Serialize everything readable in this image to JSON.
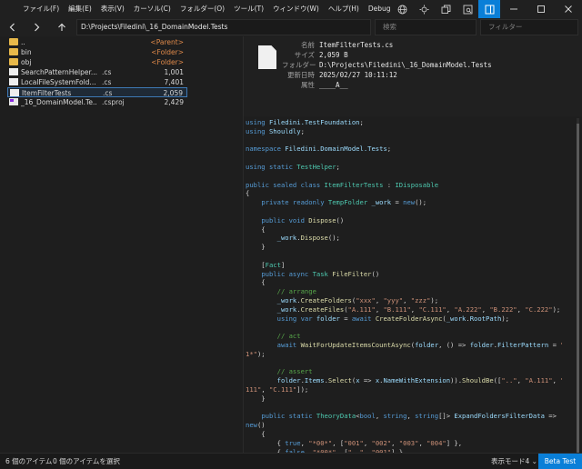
{
  "menu": [
    "ファイル(F)",
    "編集(E)",
    "表示(V)",
    "カーソル(C)",
    "フォルダー(O)",
    "ツール(T)",
    "ウィンドウ(W)",
    "ヘルプ(H)",
    "Debug"
  ],
  "toolbar": {
    "path": "D:\\Projects\\Filedini\\_16_DomainModel.Tests",
    "search_placeholder": "検索",
    "filter_placeholder": "フィルター"
  },
  "files": [
    {
      "name": "..",
      "ext": "",
      "size": "<Parent>",
      "kind": "folder"
    },
    {
      "name": "bin",
      "ext": "",
      "size": "<Folder>",
      "kind": "folder"
    },
    {
      "name": "obj",
      "ext": "",
      "size": "<Folder>",
      "kind": "folder"
    },
    {
      "name": "SearchPatternHelper...",
      "ext": ".cs",
      "size": "1,001",
      "kind": "file"
    },
    {
      "name": "LocalFileSystemFold...",
      "ext": ".cs",
      "size": "7,401",
      "kind": "file"
    },
    {
      "name": "ItemFilterTests",
      "ext": ".cs",
      "size": "2,059",
      "kind": "file",
      "selected": true
    },
    {
      "name": "_16_DomainModel.Te...",
      "ext": ".csproj",
      "size": "2,429",
      "kind": "project"
    }
  ],
  "preview": {
    "meta": [
      {
        "key": "名前",
        "value": "ItemFilterTests.cs"
      },
      {
        "key": "サイズ",
        "value": "2,059 B"
      },
      {
        "key": "フォルダー",
        "value": "D:\\Projects\\Filedini\\_16_DomainModel.Tests"
      },
      {
        "key": "更新日時",
        "value": "2025/02/27 10:11:12"
      },
      {
        "key": "属性",
        "value": "____A__"
      }
    ],
    "code": [
      [
        [
          "kw",
          "using "
        ],
        [
          "id",
          "Filedini.TestFoundation"
        ],
        [
          "pl",
          ";"
        ]
      ],
      [
        [
          "kw",
          "using "
        ],
        [
          "id",
          "Shouldly"
        ],
        [
          "pl",
          ";"
        ]
      ],
      [],
      [
        [
          "kw",
          "namespace "
        ],
        [
          "id",
          "Filedini.DomainModel.Tests"
        ],
        [
          "pl",
          ";"
        ]
      ],
      [],
      [
        [
          "kw",
          "using static "
        ],
        [
          "cls",
          "TestHelper"
        ],
        [
          "pl",
          ";"
        ]
      ],
      [],
      [
        [
          "kw",
          "public sealed class "
        ],
        [
          "cls",
          "ItemFilterTests"
        ],
        [
          "pl",
          " : "
        ],
        [
          "ty",
          "IDisposable"
        ]
      ],
      [
        [
          "pl",
          "{"
        ]
      ],
      [
        [
          "pl",
          "    "
        ],
        [
          "kw",
          "private readonly "
        ],
        [
          "cls",
          "TempFolder"
        ],
        [
          "pl",
          " "
        ],
        [
          "id",
          "_work"
        ],
        [
          "pl",
          " = "
        ],
        [
          "kw",
          "new"
        ],
        [
          "pl",
          "();"
        ]
      ],
      [],
      [
        [
          "pl",
          "    "
        ],
        [
          "kw",
          "public void "
        ],
        [
          "mt",
          "Dispose"
        ],
        [
          "pl",
          "()"
        ]
      ],
      [
        [
          "pl",
          "    {"
        ]
      ],
      [
        [
          "pl",
          "        "
        ],
        [
          "id",
          "_work"
        ],
        [
          "pl",
          "."
        ],
        [
          "mt",
          "Dispose"
        ],
        [
          "pl",
          "();"
        ]
      ],
      [
        [
          "pl",
          "    }"
        ]
      ],
      [],
      [
        [
          "pl",
          "    ["
        ],
        [
          "at",
          "Fact"
        ],
        [
          "pl",
          "]"
        ]
      ],
      [
        [
          "pl",
          "    "
        ],
        [
          "kw",
          "public async "
        ],
        [
          "cls",
          "Task"
        ],
        [
          "pl",
          " "
        ],
        [
          "mt",
          "FileFilter"
        ],
        [
          "pl",
          "()"
        ]
      ],
      [
        [
          "pl",
          "    {"
        ]
      ],
      [
        [
          "pl",
          "        "
        ],
        [
          "cm",
          "// arrange"
        ]
      ],
      [
        [
          "pl",
          "        "
        ],
        [
          "id",
          "_work"
        ],
        [
          "pl",
          "."
        ],
        [
          "mt",
          "CreateFolders"
        ],
        [
          "pl",
          "("
        ],
        [
          "st",
          "\"xxx\""
        ],
        [
          "pl",
          ", "
        ],
        [
          "st",
          "\"yyy\""
        ],
        [
          "pl",
          ", "
        ],
        [
          "st",
          "\"zzz\""
        ],
        [
          "pl",
          ");"
        ]
      ],
      [
        [
          "pl",
          "        "
        ],
        [
          "id",
          "_work"
        ],
        [
          "pl",
          "."
        ],
        [
          "mt",
          "CreateFiles"
        ],
        [
          "pl",
          "("
        ],
        [
          "st",
          "\"A.111\""
        ],
        [
          "pl",
          ", "
        ],
        [
          "st",
          "\"B.111\""
        ],
        [
          "pl",
          ", "
        ],
        [
          "st",
          "\"C.111\""
        ],
        [
          "pl",
          ", "
        ],
        [
          "st",
          "\"A.222\""
        ],
        [
          "pl",
          ", "
        ],
        [
          "st",
          "\"B.222\""
        ],
        [
          "pl",
          ", "
        ],
        [
          "st",
          "\"C.222\""
        ],
        [
          "pl",
          ");"
        ]
      ],
      [
        [
          "pl",
          "        "
        ],
        [
          "kw",
          "using var "
        ],
        [
          "id",
          "folder"
        ],
        [
          "pl",
          " = "
        ],
        [
          "kw",
          "await "
        ],
        [
          "mt",
          "CreateFolderAsync"
        ],
        [
          "pl",
          "("
        ],
        [
          "id",
          "_work"
        ],
        [
          "pl",
          "."
        ],
        [
          "id",
          "RootPath"
        ],
        [
          "pl",
          ");"
        ]
      ],
      [],
      [
        [
          "pl",
          "        "
        ],
        [
          "cm",
          "// act"
        ]
      ],
      [
        [
          "pl",
          "        "
        ],
        [
          "kw",
          "await "
        ],
        [
          "mt",
          "WaitForUpdateItemsCountAsync"
        ],
        [
          "pl",
          "("
        ],
        [
          "id",
          "folder"
        ],
        [
          "pl",
          ", () => "
        ],
        [
          "id",
          "folder"
        ],
        [
          "pl",
          "."
        ],
        [
          "id",
          "FilterPattern"
        ],
        [
          "pl",
          " = "
        ],
        [
          "st",
          "\"*."
        ]
      ],
      [
        [
          "st",
          "1*\""
        ],
        [
          "pl",
          ");"
        ]
      ],
      [],
      [
        [
          "pl",
          "        "
        ],
        [
          "cm",
          "// assert"
        ]
      ],
      [
        [
          "pl",
          "        "
        ],
        [
          "id",
          "folder"
        ],
        [
          "pl",
          "."
        ],
        [
          "id",
          "Items"
        ],
        [
          "pl",
          "."
        ],
        [
          "mt",
          "Select"
        ],
        [
          "pl",
          "("
        ],
        [
          "id",
          "x"
        ],
        [
          "pl",
          " => "
        ],
        [
          "id",
          "x"
        ],
        [
          "pl",
          "."
        ],
        [
          "id",
          "NameWithExtension"
        ],
        [
          "pl",
          "))."
        ],
        [
          "mt",
          "ShouldBe"
        ],
        [
          "pl",
          "(["
        ],
        [
          "st",
          "\"..\""
        ],
        [
          "pl",
          ", "
        ],
        [
          "st",
          "\"A.111\""
        ],
        [
          "pl",
          ", "
        ],
        [
          "st",
          "\"B."
        ]
      ],
      [
        [
          "st",
          "111\""
        ],
        [
          "pl",
          ", "
        ],
        [
          "st",
          "\"C.111\""
        ],
        [
          "pl",
          "]);"
        ]
      ],
      [
        [
          "pl",
          "    }"
        ]
      ],
      [],
      [
        [
          "pl",
          "    "
        ],
        [
          "kw",
          "public static "
        ],
        [
          "cls",
          "TheoryData"
        ],
        [
          "pl",
          "<"
        ],
        [
          "kw",
          "bool"
        ],
        [
          "pl",
          ", "
        ],
        [
          "kw",
          "string"
        ],
        [
          "pl",
          ", "
        ],
        [
          "kw",
          "string"
        ],
        [
          "pl",
          "[]> "
        ],
        [
          "id",
          "ExpandFoldersFilterData"
        ],
        [
          "pl",
          " =>"
        ]
      ],
      [
        [
          "kw",
          "new"
        ],
        [
          "pl",
          "()"
        ]
      ],
      [
        [
          "pl",
          "    {"
        ]
      ],
      [
        [
          "pl",
          "        { "
        ],
        [
          "kw",
          "true"
        ],
        [
          "pl",
          ", "
        ],
        [
          "st",
          "\"*00*\""
        ],
        [
          "pl",
          ", ["
        ],
        [
          "st",
          "\"001\""
        ],
        [
          "pl",
          ", "
        ],
        [
          "st",
          "\"002\""
        ],
        [
          "pl",
          ", "
        ],
        [
          "st",
          "\"003\""
        ],
        [
          "pl",
          ", "
        ],
        [
          "st",
          "\"004\""
        ],
        [
          "pl",
          "] },"
        ]
      ],
      [
        [
          "pl",
          "        { "
        ],
        [
          "kw",
          "false"
        ],
        [
          "pl",
          ", "
        ],
        [
          "st",
          "\"*00*\""
        ],
        [
          "pl",
          ", ["
        ],
        [
          "st",
          "\"..\""
        ],
        [
          "pl",
          ", "
        ],
        [
          "st",
          "\"001\""
        ],
        [
          "pl",
          "] },"
        ]
      ]
    ]
  },
  "status": {
    "item_count": "6 個のアイテム",
    "selected_count": "0 個のアイテムを選択",
    "display_mode": "表示モード4",
    "beta": "Beta Test"
  }
}
